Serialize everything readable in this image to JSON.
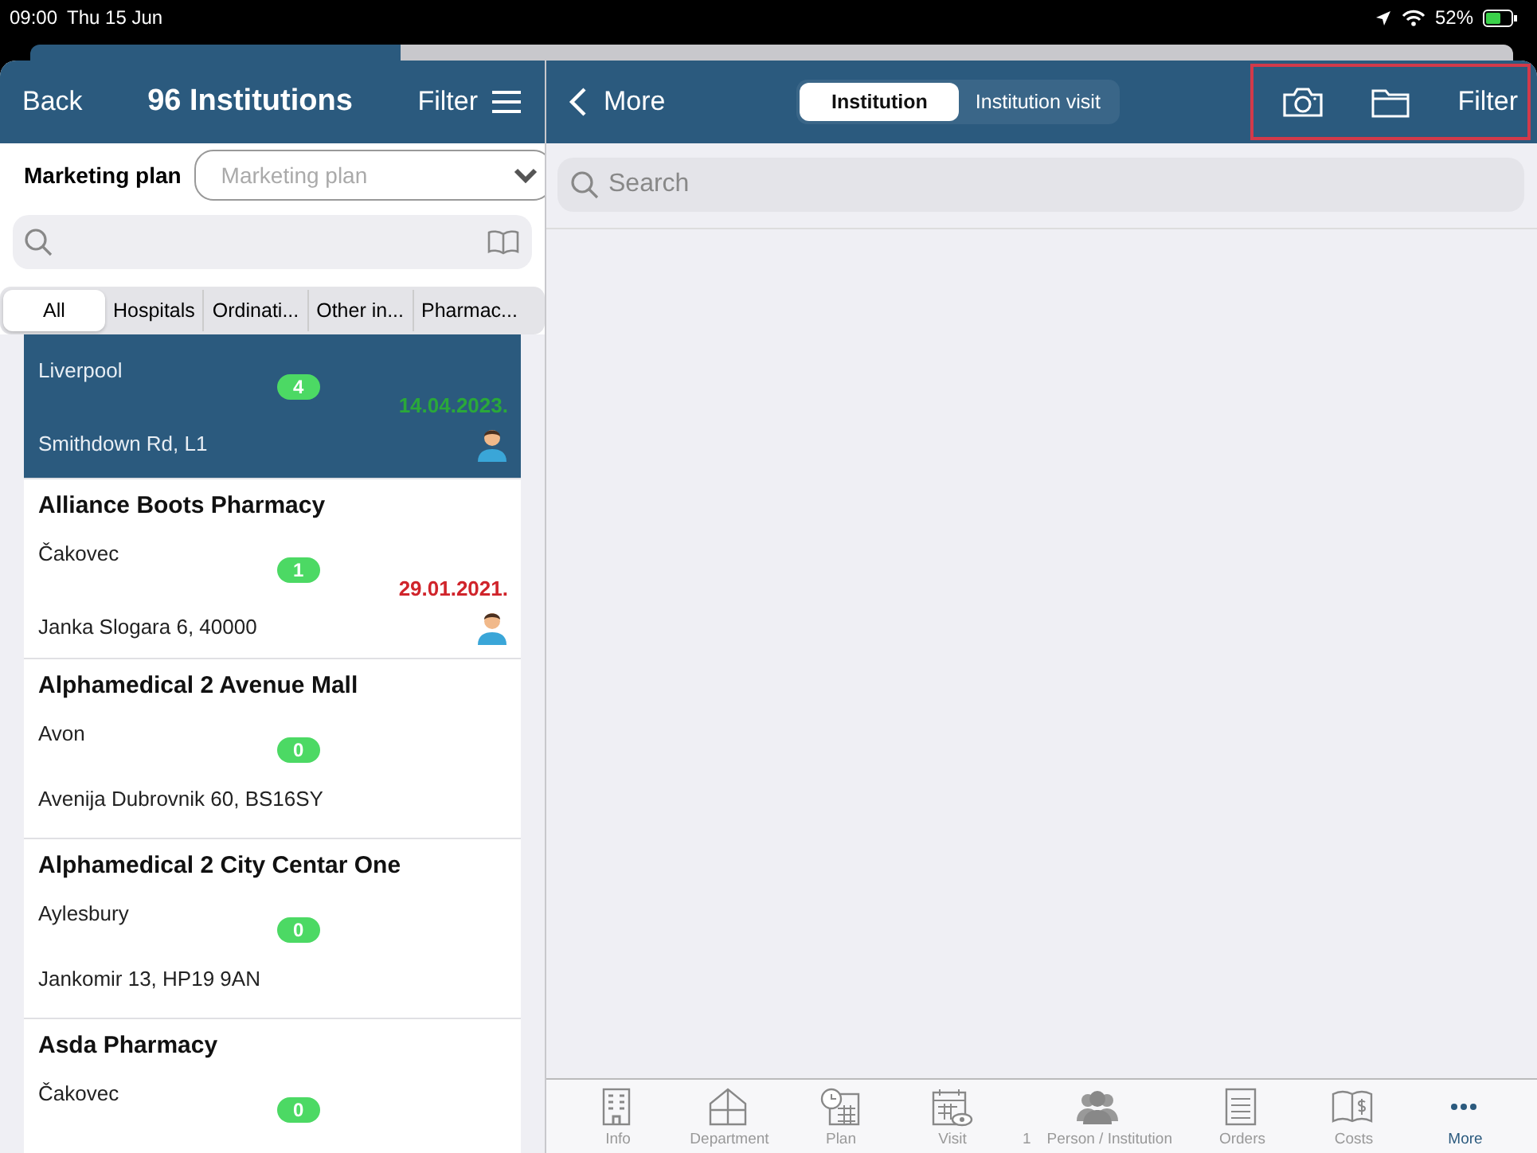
{
  "status_bar": {
    "time": "09:00",
    "date": "Thu 15 Jun",
    "battery": "52%"
  },
  "left_nav": {
    "back": "Back",
    "title": "96 Institutions",
    "filter": "Filter"
  },
  "marketing_plan": {
    "label": "Marketing plan",
    "placeholder": "Marketing plan"
  },
  "segments": [
    {
      "label": "All",
      "selected": true
    },
    {
      "label": "Hospitals",
      "selected": false
    },
    {
      "label": "Ordinati...",
      "selected": false
    },
    {
      "label": "Other in...",
      "selected": false
    },
    {
      "label": "Pharmac...",
      "selected": false
    }
  ],
  "institutions": [
    {
      "city": "Liverpool",
      "address": "Smithdown Rd, L1",
      "count": "4",
      "date": "14.04.2023.",
      "color": "#2aa83a",
      "assigned": true,
      "selected": true
    },
    {
      "name": "Alliance Boots Pharmacy",
      "city": "Čakovec",
      "address": "Janka Slogara 6, 40000",
      "count": "1",
      "date": "29.01.2021.",
      "color": "#d0242b",
      "assigned": true,
      "selected": false
    },
    {
      "name": "Alphamedical 2 Avenue Mall",
      "city": "Avon",
      "address": "Avenija Dubrovnik 60, BS16SY",
      "count": "0",
      "assigned": false,
      "selected": false
    },
    {
      "name": "Alphamedical 2 City Centar One",
      "city": "Aylesbury",
      "address": "Jankomir 13, HP19 9AN",
      "count": "0",
      "assigned": false,
      "selected": false
    },
    {
      "name": "Asda Pharmacy",
      "city": "Čakovec",
      "count": "0",
      "assigned": false,
      "selected": false
    }
  ],
  "right_nav": {
    "back": "More",
    "tabs": [
      {
        "label": "Institution",
        "selected": true
      },
      {
        "label": "Institution visit",
        "selected": false
      }
    ],
    "filter": "Filter"
  },
  "search": {
    "placeholder": "Search"
  },
  "tab_bar": [
    {
      "kind": "building",
      "label": "Info",
      "selected": false
    },
    {
      "kind": "house",
      "label": "Department",
      "selected": false
    },
    {
      "kind": "plan",
      "label": "Plan",
      "selected": false
    },
    {
      "kind": "visit",
      "label": "Visit",
      "selected": false
    },
    {
      "kind": "people",
      "label": "Person / Institution",
      "badge": "1",
      "selected": false
    },
    {
      "kind": "list",
      "label": "Orders",
      "selected": false
    },
    {
      "kind": "book",
      "label": "Costs",
      "selected": false
    },
    {
      "kind": "dots",
      "label": "More",
      "selected": true
    }
  ]
}
